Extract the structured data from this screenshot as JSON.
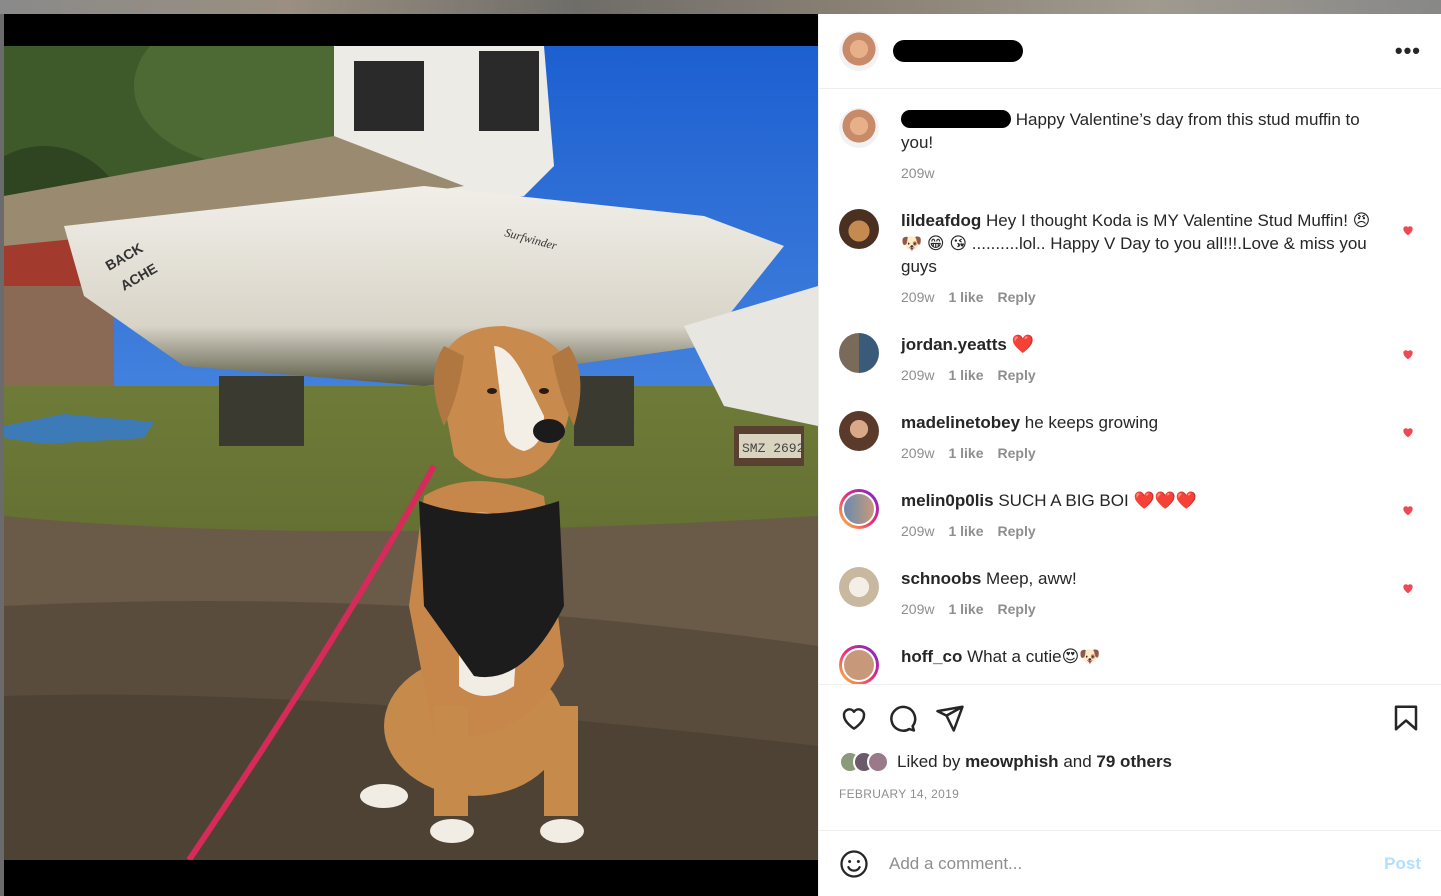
{
  "post": {
    "caption": {
      "text": "Happy Valentine’s day from this stud muffin to you!",
      "time": "209w"
    },
    "photo": {
      "boat_name": "BACK ACHE",
      "boat_model": "Surfwinder",
      "plate": "SMZ 2692"
    }
  },
  "comments": [
    {
      "user": "lildeafdog",
      "text": "Hey I thought Koda is MY Valentine Stud Muffin! 😠 🐶 😁 😘 ..........lol.. Happy V Day to you all!!!.Love & miss you guys",
      "time": "209w",
      "likes": "1 like",
      "reply": "Reply"
    },
    {
      "user": "jordan.yeatts",
      "text": "❤️",
      "time": "209w",
      "likes": "1 like",
      "reply": "Reply"
    },
    {
      "user": "madelinetobey",
      "text": "he keeps growing",
      "time": "209w",
      "likes": "1 like",
      "reply": "Reply"
    },
    {
      "user": "melin0p0lis",
      "text": "SUCH A BIG BOI ❤️❤️❤️",
      "time": "209w",
      "likes": "1 like",
      "reply": "Reply"
    },
    {
      "user": "schnoobs",
      "text": "Meep, aww!",
      "time": "209w",
      "likes": "1 like",
      "reply": "Reply"
    },
    {
      "user": "hoff_co",
      "text": "What a cutie😍🐶",
      "time": "",
      "likes": "",
      "reply": ""
    }
  ],
  "likes": {
    "prefix": "Liked by",
    "user": "meowphish",
    "and": "and",
    "others": "79 others"
  },
  "date": "FEBRUARY 14, 2019",
  "add_comment": {
    "placeholder": "Add a comment...",
    "post_label": "Post"
  },
  "colors": {
    "heart": "#ed4956",
    "post_disabled": "#b2dffc",
    "border": "#efefef",
    "muted": "#8e8e8e"
  }
}
